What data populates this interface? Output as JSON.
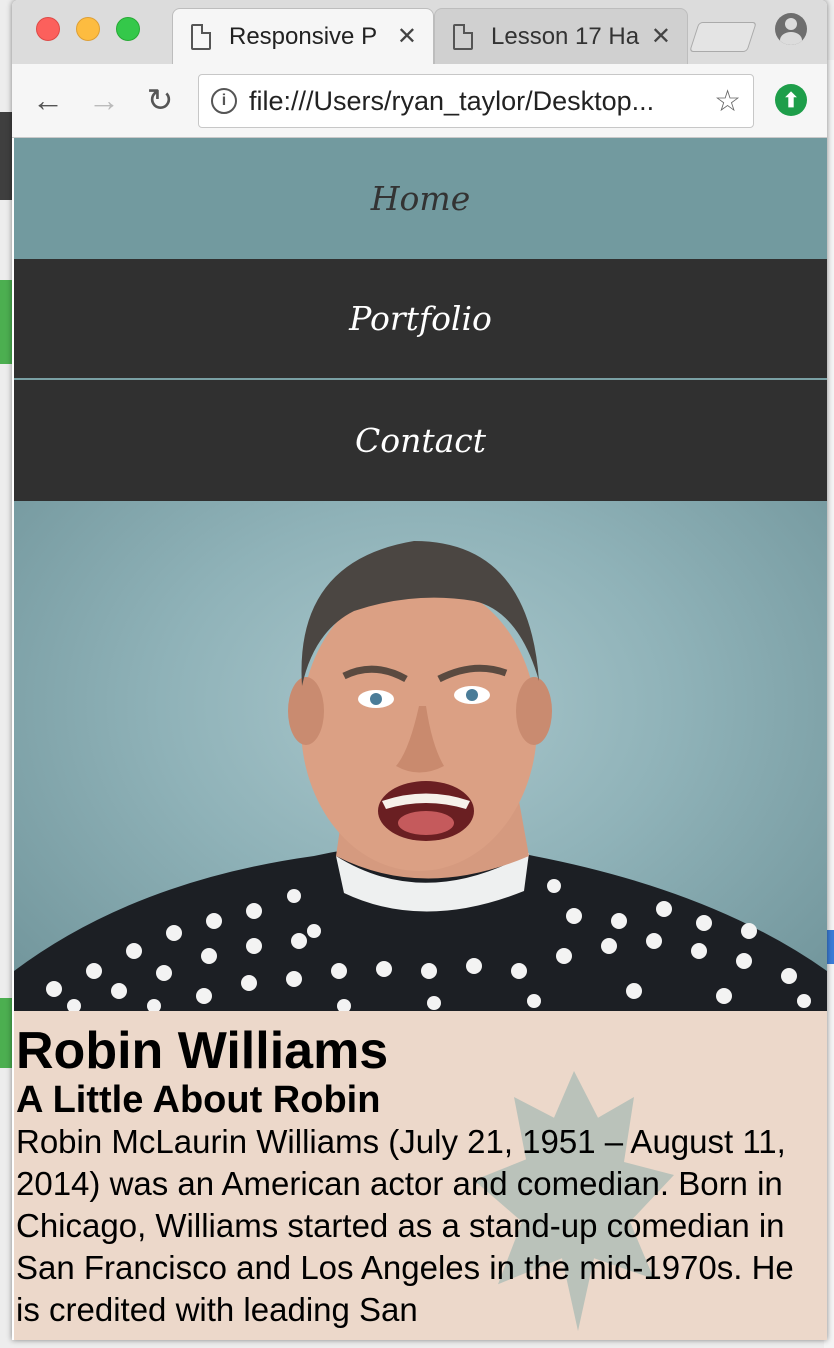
{
  "browser": {
    "tabs": [
      {
        "title": "Responsive P",
        "active": true
      },
      {
        "title": "Lesson 17 Ha",
        "active": false
      }
    ],
    "url": "file:///Users/ryan_taylor/Desktop..."
  },
  "nav": {
    "items": [
      "Home",
      "Portfolio",
      "Contact"
    ]
  },
  "hero": {
    "image": "portrait-photo"
  },
  "bio": {
    "name": "Robin Williams",
    "subtitle": "A Little About Robin",
    "text": "Robin McLaurin Williams (July 21, 1951 – August 11, 2014) was an American actor and comedian. Born in Chicago, Williams started as a stand-up comedian in San Francisco and Los Angeles in the mid-1970s. He is credited with leading San"
  },
  "colors": {
    "nav_active": "#729a9f",
    "nav_dark": "#303030",
    "bio_bg": "#ecd8ca"
  }
}
